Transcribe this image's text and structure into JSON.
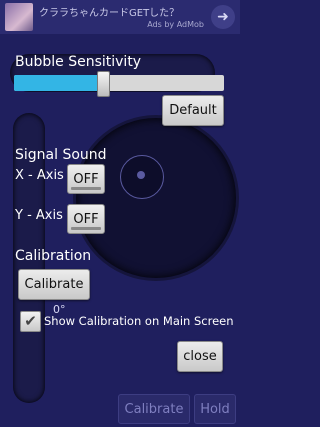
{
  "ad": {
    "title": "クララちゃんカードGETした？",
    "attribution": "Ads by AdMob",
    "arrow_icon": "arrow-right-icon"
  },
  "sensitivity": {
    "label": "Bubble Sensitivity",
    "value_fraction": 0.42,
    "fill_color": "#33b5e5",
    "default_label": "Default"
  },
  "signal_sound": {
    "label": "Signal Sound",
    "x_label": "X - Axis",
    "x_value": "OFF",
    "y_label": "Y - Axis",
    "y_value": "OFF"
  },
  "calibration": {
    "label": "Calibration",
    "button_label": "Calibrate",
    "degree_readout": "0°",
    "show_checkbox_label": "Show Calibration on Main Screen",
    "show_checked": true
  },
  "dialog": {
    "close_label": "close"
  },
  "background_toolbar": {
    "calibrate_label": "Calibrate",
    "hold_label": "Hold"
  }
}
